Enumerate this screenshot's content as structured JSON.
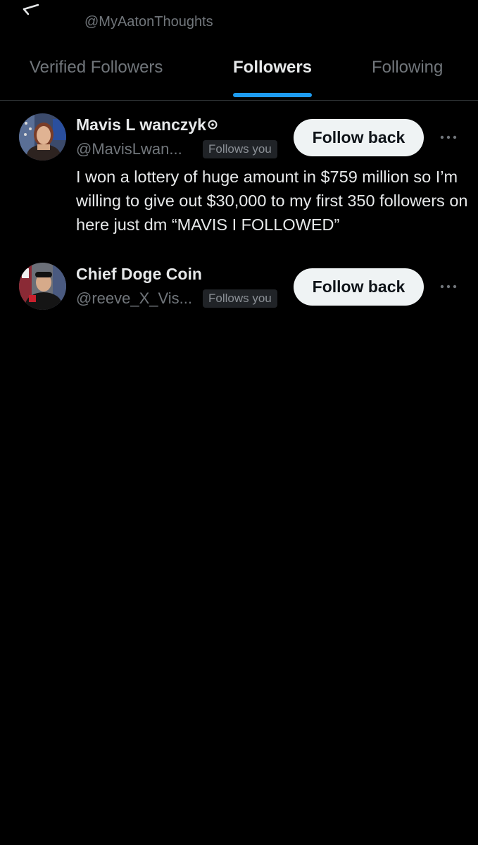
{
  "header": {
    "back_icon": "back-arrow-icon",
    "handle": "@MyAatonThoughts"
  },
  "tabs": [
    {
      "label": "Verified Followers",
      "active": false
    },
    {
      "label": "Followers",
      "active": true
    },
    {
      "label": "Following",
      "active": false
    }
  ],
  "accent_color": "#1d9bf0",
  "followers": [
    {
      "name": "Mavis L wanczyk",
      "badge_icon": "badge-icon",
      "handle": "@MavisLwan...",
      "follows_you": "Follows you",
      "button": "Follow back",
      "more_icon": "more-dots-icon",
      "bio": "I won a lottery of huge amount in $759 million so I’m willing to give out $30,000 to my first 350 followers on here just dm “MAVIS I FOLLOWED”"
    },
    {
      "name": "Chief Doge Coin",
      "handle": "@reeve_X_Vis...",
      "follows_you": "Follows you",
      "button": "Follow back",
      "more_icon": "more-dots-icon"
    }
  ]
}
